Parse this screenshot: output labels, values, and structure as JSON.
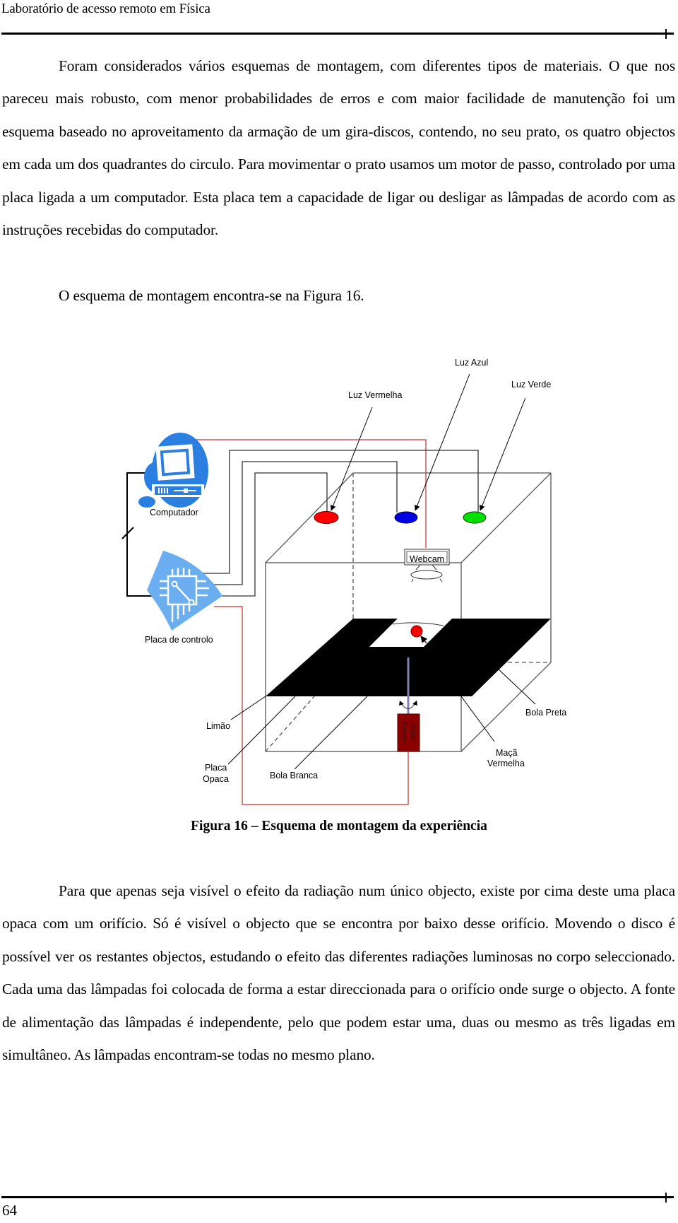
{
  "header": {
    "title": "Laboratório de acesso remoto em Física"
  },
  "paragraphs": {
    "p1": "Foram considerados vários esquemas de montagem, com diferentes tipos de materiais. O que nos pareceu mais robusto, com menor probabilidades de erros e com maior facilidade de manutenção foi um esquema baseado no aproveitamento da armação de um gira-discos, contendo, no seu prato, os quatro objectos em cada um dos quadrantes do circulo. Para movimentar o prato usamos um motor de passo, controlado por uma placa ligada a um computador. Esta placa tem a capacidade de ligar ou desligar as lâmpadas de acordo com as instruções recebidas do computador.",
    "p2": "O esquema de montagem encontra-se na Figura 16.",
    "p3": "Para que apenas seja visível o efeito da radiação num único objecto, existe por cima deste uma placa opaca com um orifício. Só é visível o objecto que se encontra por baixo desse orifício. Movendo o disco é possível ver os restantes objectos, estudando o efeito das diferentes radiações luminosas no corpo seleccionado. Cada uma das lâmpadas foi colocada de forma a estar direccionada para o orifício onde surge o objecto. A fonte de alimentação das lâmpadas é independente, pelo que podem estar uma, duas ou mesmo as três ligadas em simultâneo. As lâmpadas encontram-se todas no mesmo plano."
  },
  "figure": {
    "caption": "Figura 16 – Esquema de montagem da experiência",
    "labels": {
      "luz_azul": "Luz Azul",
      "luz_verde": "Luz Verde",
      "luz_vermelha": "Luz Vermelha",
      "computador": "Computador",
      "webcam": "Webcam",
      "placa_controlo": "Placa de controlo",
      "bola_preta": "Bola Preta",
      "limao": "Limão",
      "motor_line1": "Motor",
      "motor_line2": "Passo",
      "maca_line1": "Maçã",
      "maca_line2": "Vermelha",
      "placa_opaca_line1": "Placa",
      "placa_opaca_line2": "Opaca",
      "bola_branca": "Bola Branca"
    },
    "colors": {
      "red_light": "#ff0000",
      "blue_light": "#0000e0",
      "green_light": "#00e000",
      "computer_icon": "#2a7fe0",
      "board_icon": "#6aaef0",
      "motor": "#8b0000",
      "red_wire": "#c03030",
      "shaft": "#8080b0"
    }
  },
  "footer": {
    "page_number": "64"
  }
}
